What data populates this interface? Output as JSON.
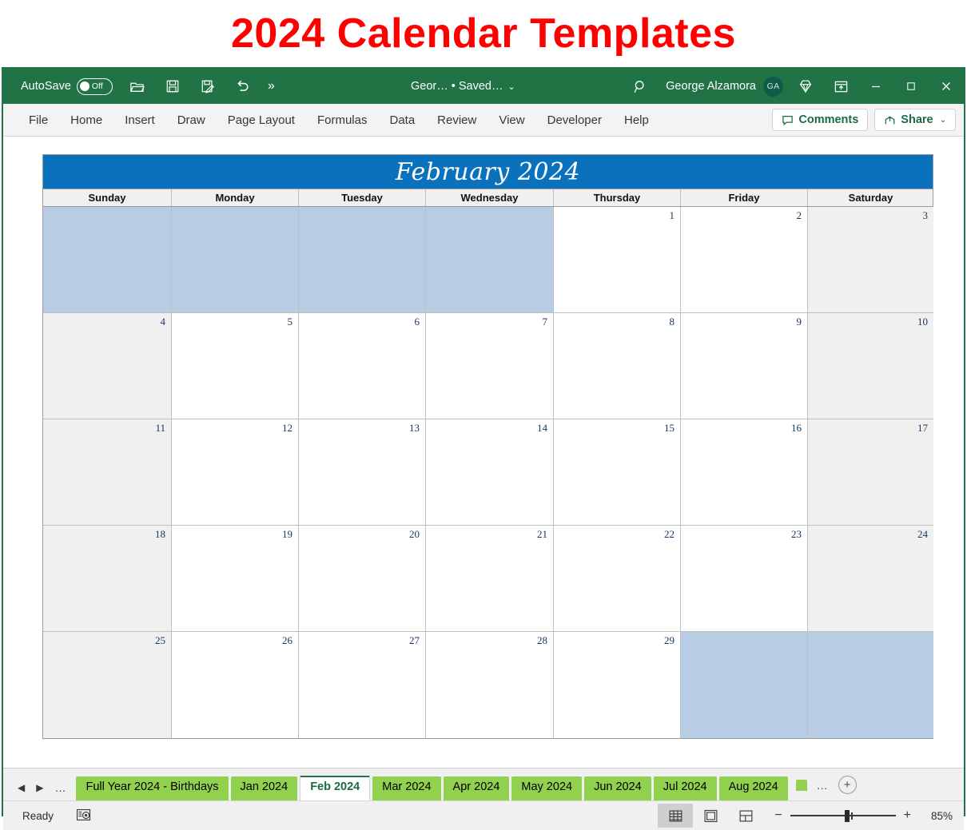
{
  "banner": {
    "title": "2024 Calendar Templates",
    "color": "#FF0000"
  },
  "titlebar": {
    "autosave_label": "AutoSave",
    "autosave_state": "Off",
    "quick_access": [
      {
        "name": "open-file-icon",
        "tip": "Open"
      },
      {
        "name": "save-icon",
        "tip": "Save"
      },
      {
        "name": "save-as-icon",
        "tip": "Save As"
      },
      {
        "name": "undo-icon",
        "tip": "Undo"
      }
    ],
    "more_commands": "»",
    "document_title": "Geor… • Saved…",
    "document_caret": "⌄",
    "account_name": "George Alzamora",
    "account_initials": "GA",
    "window_minimize": "—",
    "window_maximize": "□",
    "window_close": "✕"
  },
  "ribbon": {
    "tabs": [
      {
        "label": "File"
      },
      {
        "label": "Home"
      },
      {
        "label": "Insert"
      },
      {
        "label": "Draw"
      },
      {
        "label": "Page Layout"
      },
      {
        "label": "Formulas"
      },
      {
        "label": "Data"
      },
      {
        "label": "Review"
      },
      {
        "label": "View"
      },
      {
        "label": "Developer"
      },
      {
        "label": "Help"
      }
    ],
    "comments_label": "Comments",
    "share_label": "Share",
    "share_caret": "⌄"
  },
  "calendar": {
    "title": "February 2024",
    "title_bg": "#0A72BC",
    "selection_color": "#B8CCE4",
    "weekend_color": "#F0F0F0",
    "day_headers": [
      "Sunday",
      "Monday",
      "Tuesday",
      "Wednesday",
      "Thursday",
      "Friday",
      "Saturday"
    ],
    "weeks": [
      [
        {
          "day": "",
          "state": "selected"
        },
        {
          "day": "",
          "state": "selected"
        },
        {
          "day": "",
          "state": "selected"
        },
        {
          "day": "",
          "state": "selected"
        },
        {
          "day": "1",
          "state": "weekday"
        },
        {
          "day": "2",
          "state": "weekday"
        },
        {
          "day": "3",
          "state": "weekend"
        }
      ],
      [
        {
          "day": "4",
          "state": "weekend"
        },
        {
          "day": "5",
          "state": "weekday"
        },
        {
          "day": "6",
          "state": "weekday"
        },
        {
          "day": "7",
          "state": "weekday"
        },
        {
          "day": "8",
          "state": "weekday"
        },
        {
          "day": "9",
          "state": "weekday"
        },
        {
          "day": "10",
          "state": "weekend"
        }
      ],
      [
        {
          "day": "11",
          "state": "weekend"
        },
        {
          "day": "12",
          "state": "weekday"
        },
        {
          "day": "13",
          "state": "weekday"
        },
        {
          "day": "14",
          "state": "weekday"
        },
        {
          "day": "15",
          "state": "weekday"
        },
        {
          "day": "16",
          "state": "weekday"
        },
        {
          "day": "17",
          "state": "weekend"
        }
      ],
      [
        {
          "day": "18",
          "state": "weekend"
        },
        {
          "day": "19",
          "state": "weekday"
        },
        {
          "day": "20",
          "state": "weekday"
        },
        {
          "day": "21",
          "state": "weekday"
        },
        {
          "day": "22",
          "state": "weekday"
        },
        {
          "day": "23",
          "state": "weekday"
        },
        {
          "day": "24",
          "state": "weekend"
        }
      ],
      [
        {
          "day": "25",
          "state": "weekend"
        },
        {
          "day": "26",
          "state": "weekday"
        },
        {
          "day": "27",
          "state": "weekday"
        },
        {
          "day": "28",
          "state": "weekday"
        },
        {
          "day": "29",
          "state": "weekday"
        },
        {
          "day": "",
          "state": "selected"
        },
        {
          "day": "",
          "state": "selected"
        }
      ]
    ]
  },
  "sheet_tabs": {
    "first_arrow": "◀",
    "next_arrow": "▶",
    "left_overflow": "…",
    "right_overflow": "…",
    "add_sheet": "+",
    "tabs": [
      {
        "label": "Full Year 2024 - Birthdays",
        "active": false
      },
      {
        "label": "Jan 2024",
        "active": false
      },
      {
        "label": "Feb 2024",
        "active": true
      },
      {
        "label": "Mar 2024",
        "active": false
      },
      {
        "label": "Apr 2024",
        "active": false
      },
      {
        "label": "May 2024",
        "active": false
      },
      {
        "label": "Jun 2024",
        "active": false
      },
      {
        "label": "Jul 2024",
        "active": false
      },
      {
        "label": "Aug 2024",
        "active": false
      }
    ]
  },
  "statusbar": {
    "state": "Ready",
    "accessibility_icon": "accessibility-checker-icon",
    "views": [
      {
        "name": "normal-view",
        "active": true
      },
      {
        "name": "page-layout-view",
        "active": false
      },
      {
        "name": "page-break-preview-view",
        "active": false
      }
    ],
    "zoom_out": "−",
    "zoom_in": "+",
    "zoom_level": "85%"
  }
}
